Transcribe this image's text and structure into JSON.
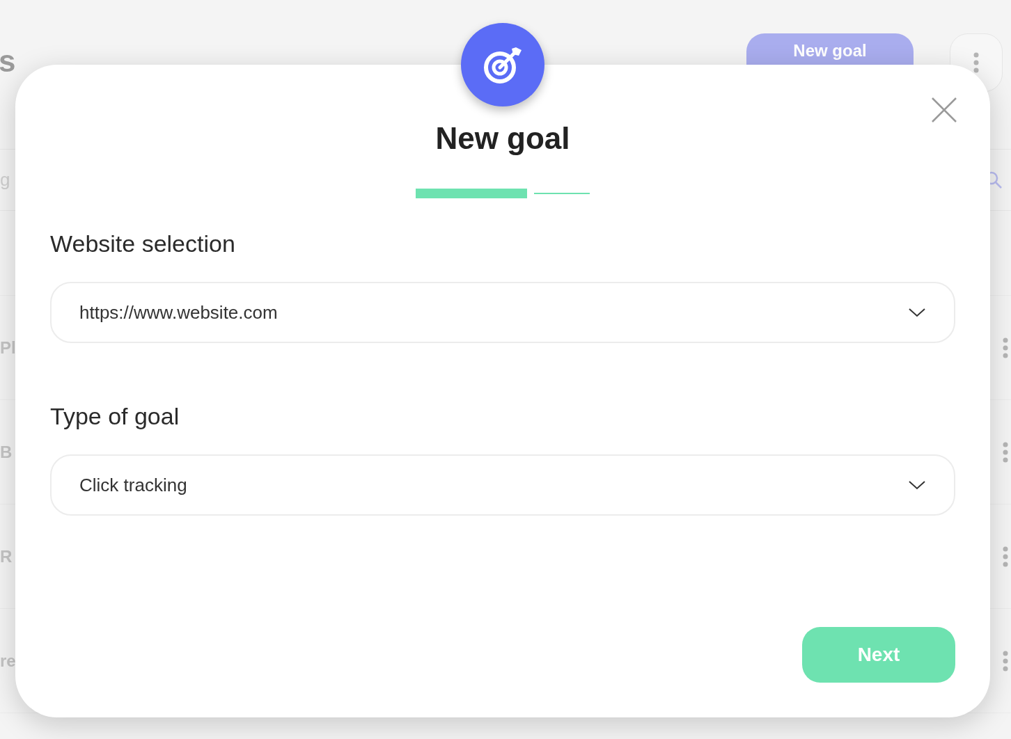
{
  "background": {
    "heading": "s",
    "new_goal_button": "New goal",
    "search_text": "g",
    "rows": [
      {
        "label": "Pl"
      },
      {
        "label": "B"
      },
      {
        "label": "R"
      },
      {
        "label": "re"
      }
    ]
  },
  "dialog": {
    "title": "New goal",
    "steps": [
      {
        "selected": true
      },
      {
        "selected": false
      }
    ],
    "fields": [
      {
        "label": "Website selection",
        "value": "https://www.website.com"
      },
      {
        "label": "Type of goal",
        "value": "Click tracking"
      }
    ],
    "next_button": "Next"
  }
}
